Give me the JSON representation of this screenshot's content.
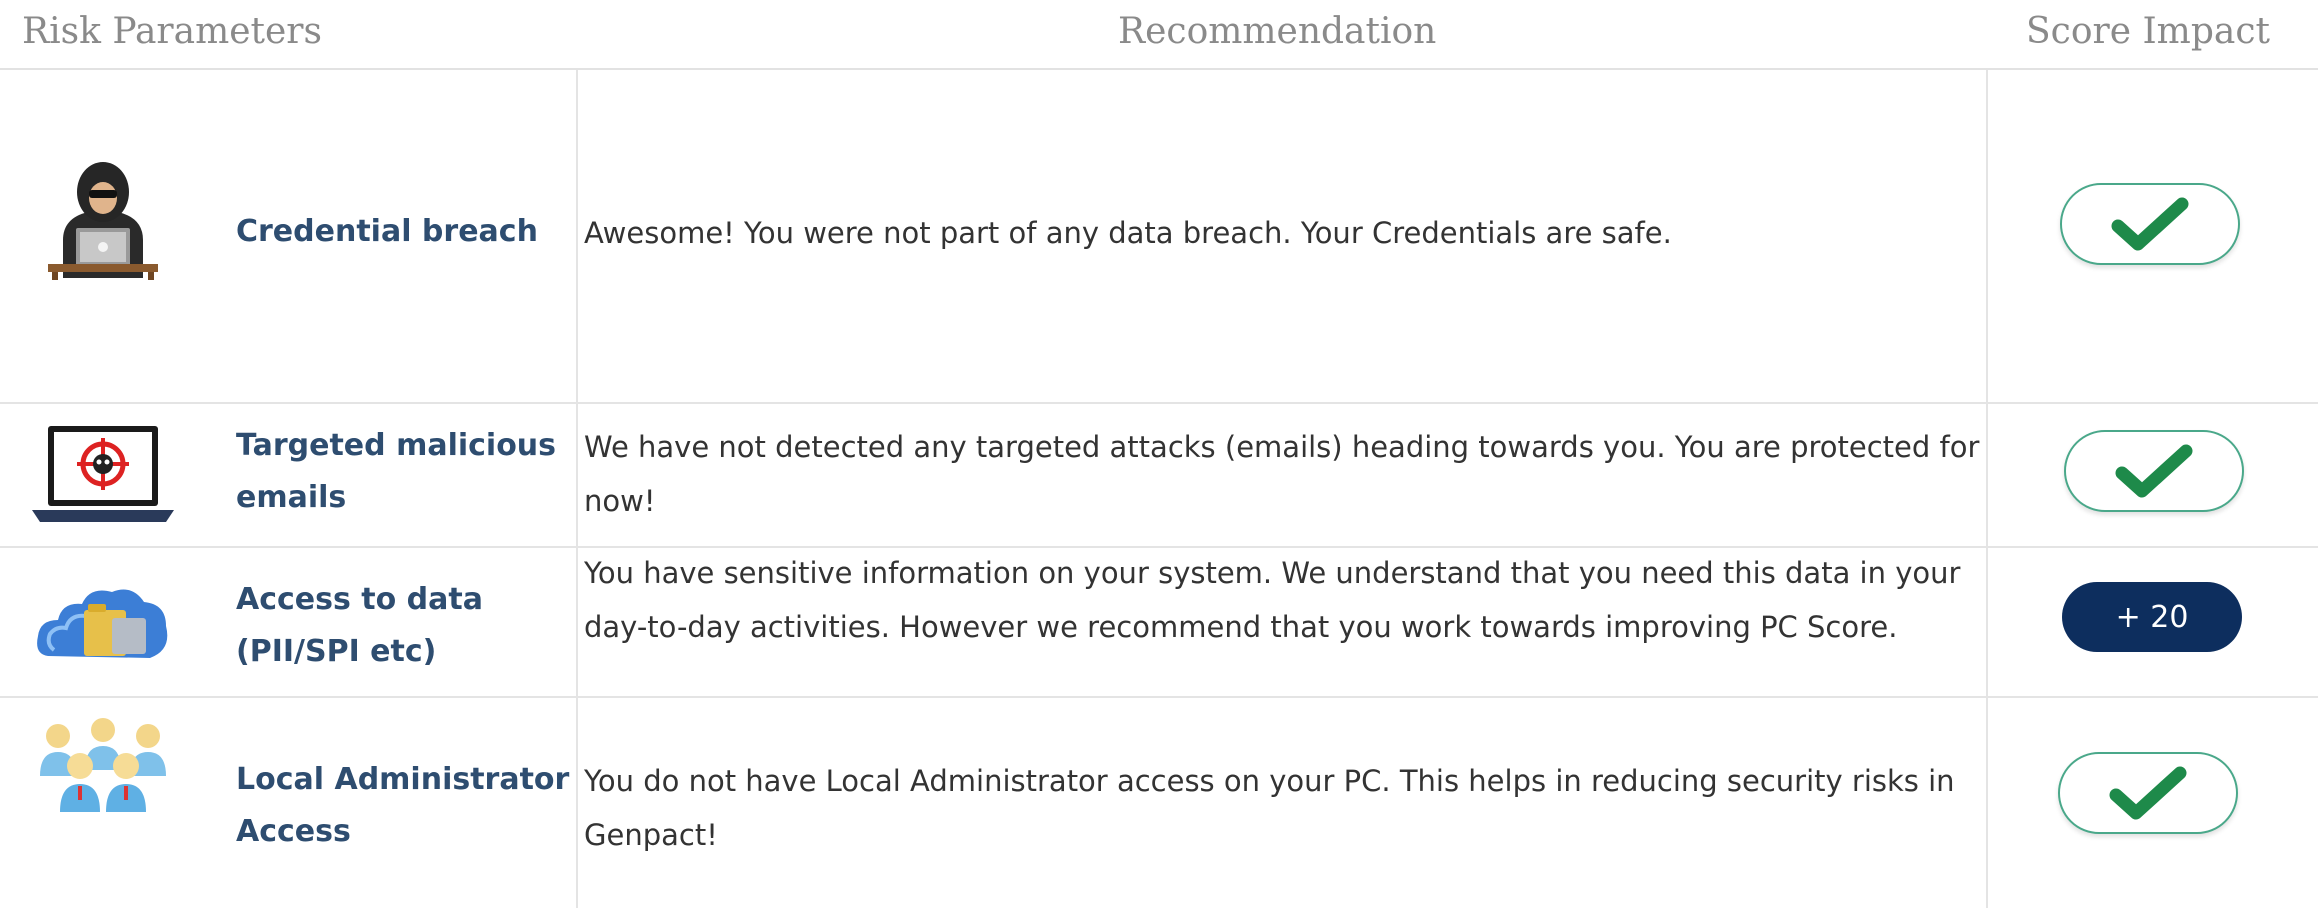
{
  "table": {
    "headers": {
      "risk_parameters": "Risk Parameters",
      "recommendation": "Recommendation",
      "score_impact": "Score Impact"
    },
    "rows": [
      {
        "icon": "hacker-icon",
        "parameter": "Credential breach",
        "recommendation": "Awesome! You were not part of any data breach. Your Credentials are safe.",
        "score_impact": "check",
        "status_color": "#1e8a4a"
      },
      {
        "icon": "malicious-email-laptop-icon",
        "parameter": "Targeted malicious emails",
        "recommendation": "We have not detected any targeted attacks (emails) heading towards you. You are protected for now!",
        "score_impact": "check",
        "status_color": "#1e8a4a"
      },
      {
        "icon": "data-folders-icon",
        "parameter": "Access to data (PII/SPI etc)",
        "recommendation": "You have sensitive information on your system. We understand that you need this data in your day-to-day activities. However we recommend that you work towards improving PC Score.",
        "score_impact": "+ 20",
        "status_color": "#0d2e5e"
      },
      {
        "icon": "user-group-icon",
        "parameter": "Local Administrator Access",
        "recommendation": "You do not have Local Administrator access on your PC. This helps in reducing security risks in Genpact!",
        "score_impact": "check",
        "status_color": "#1e8a4a"
      }
    ]
  }
}
